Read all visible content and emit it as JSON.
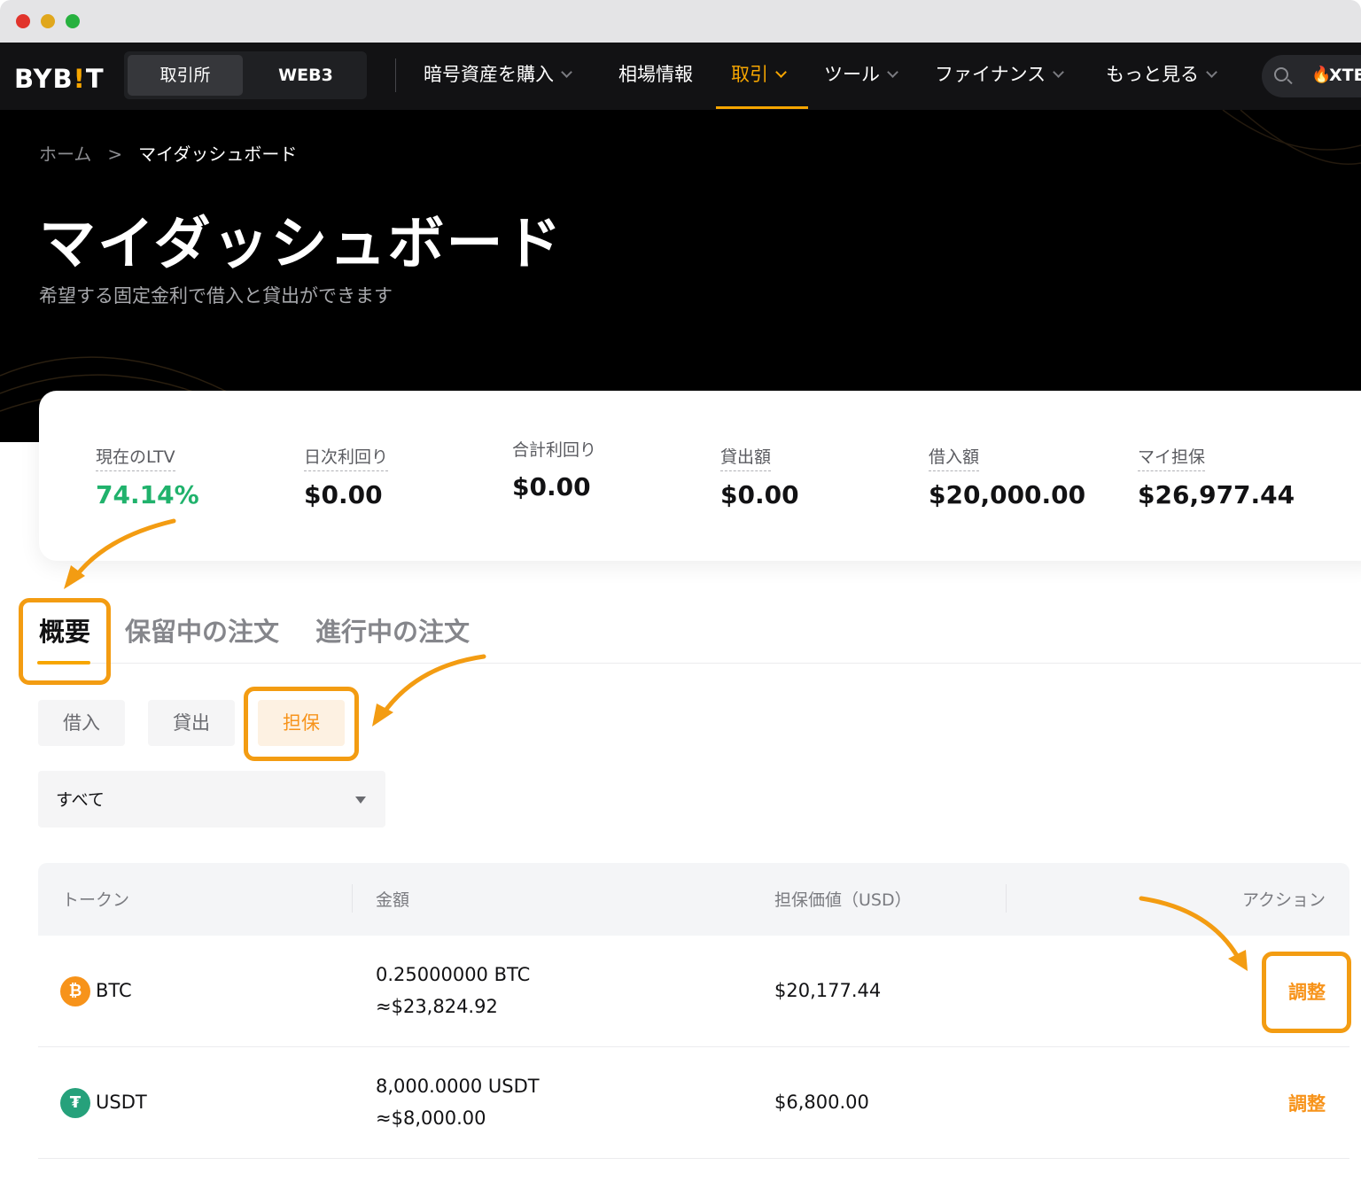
{
  "navbar": {
    "logo": "BYB!T",
    "segment": {
      "exchange": "取引所",
      "web3": "WEB3"
    },
    "items": [
      {
        "label": "暗号資産を購入",
        "has_dropdown": true
      },
      {
        "label": "相場情報",
        "has_dropdown": false
      },
      {
        "label": "取引",
        "has_dropdown": true,
        "active": true
      },
      {
        "label": "ツール",
        "has_dropdown": true
      },
      {
        "label": "ファイナンス",
        "has_dropdown": true
      },
      {
        "label": "もっと見る",
        "has_dropdown": true
      }
    ],
    "search_text": "XTE"
  },
  "breadcrumb": {
    "home": "ホーム",
    "separator": ">",
    "current": "マイダッシュボード"
  },
  "page": {
    "title": "マイダッシュボード",
    "subtitle": "希望する固定金利で借入と貸出ができます"
  },
  "stats": [
    {
      "label": "現在のLTV",
      "value": "74.14%",
      "color": "#20b26c"
    },
    {
      "label": "日次利回り",
      "value": "$0.00"
    },
    {
      "label": "合計利回り",
      "value": "$0.00"
    },
    {
      "label": "貸出額",
      "value": "$0.00"
    },
    {
      "label": "借入額",
      "value": "$20,000.00"
    },
    {
      "label": "マイ担保",
      "value": "$26,977.44"
    }
  ],
  "tabs": [
    {
      "label": "概要",
      "active": true
    },
    {
      "label": "保留中の注文"
    },
    {
      "label": "進行中の注文"
    }
  ],
  "subtabs": [
    {
      "label": "借入"
    },
    {
      "label": "貸出"
    },
    {
      "label": "担保",
      "active": true
    }
  ],
  "filter": {
    "selected": "すべて"
  },
  "table": {
    "headers": [
      "トークン",
      "金額",
      "担保価値（USD）",
      "アクション"
    ],
    "rows": [
      {
        "token": "BTC",
        "icon_glyph": "₿",
        "amount": "0.25000000 BTC",
        "amount_usd": "≈$23,824.92",
        "collateral_value": "$20,177.44",
        "action": "調整"
      },
      {
        "token": "USDT",
        "icon_glyph": "₮",
        "amount": "8,000.0000 USDT",
        "amount_usd": "≈$8,000.00",
        "collateral_value": "$6,800.00",
        "action": "調整"
      }
    ]
  },
  "colors": {
    "accent": "#f7a600",
    "annotation": "#f39c12",
    "positive": "#20b26c",
    "btc": "#f7931a",
    "usdt": "#26a17b"
  }
}
